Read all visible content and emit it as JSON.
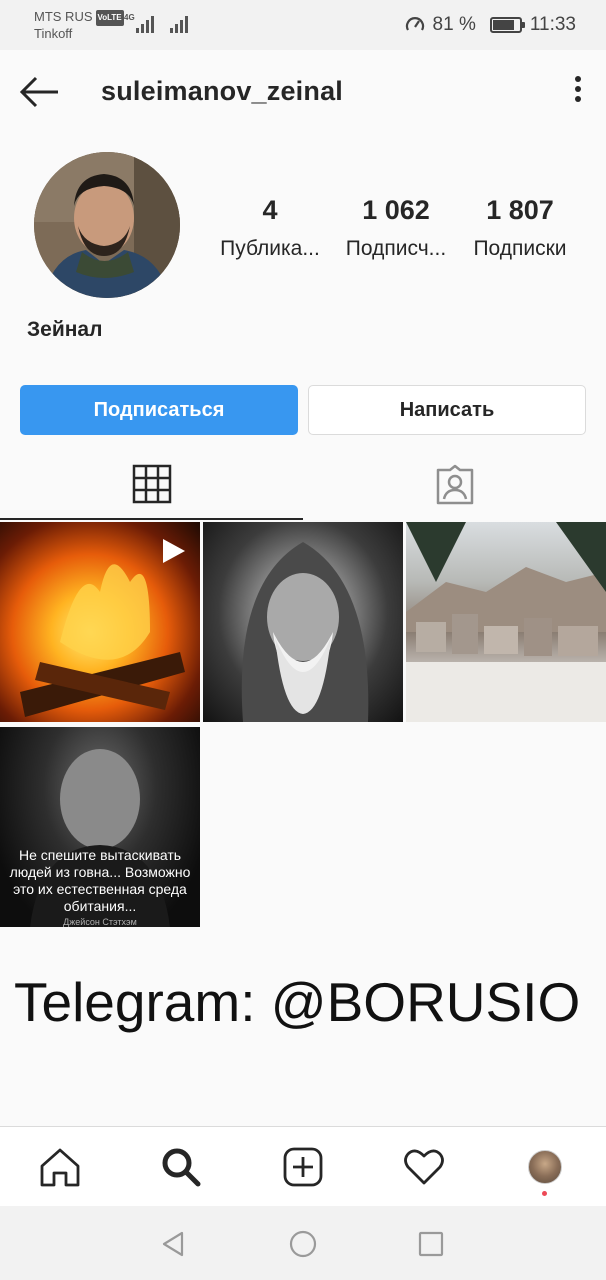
{
  "status_bar": {
    "carrier": "MTS RUS",
    "volte": "VoLTE",
    "network": "4G",
    "operator2": "Tinkoff",
    "battery_percent": "81 %",
    "battery_level": 0.81,
    "time": "11:33"
  },
  "header": {
    "username": "suleimanov_zeinal"
  },
  "profile": {
    "posts_count": "4",
    "posts_label": "Публика...",
    "followers_count": "1 062",
    "followers_label": "Подписч...",
    "following_count": "1 807",
    "following_label": "Подписки",
    "full_name": "Зейнал",
    "follow_label": "Подписаться",
    "message_label": "Написать"
  },
  "tabs": [
    "grid-icon",
    "tagged-icon"
  ],
  "posts": [
    {
      "kind": "video",
      "subject": "fire"
    },
    {
      "kind": "photo",
      "subject": "old-man"
    },
    {
      "kind": "photo",
      "subject": "winter-city"
    },
    {
      "kind": "photo",
      "subject": "quote",
      "quote_lines": [
        "Не спешите вытаскивать",
        "людей из говна... Возможно",
        "это их естественная среда",
        "обитания..."
      ],
      "quote_author": "Джейсон Стэтхэм"
    }
  ],
  "overlay_text": "Telegram: @BORUSIO",
  "bottom_nav": [
    "home-icon",
    "search-icon",
    "add-post-icon",
    "activity-heart-icon",
    "profile-avatar"
  ],
  "colors": {
    "accent": "#3897f0",
    "notification_dot": "#ed4956"
  }
}
